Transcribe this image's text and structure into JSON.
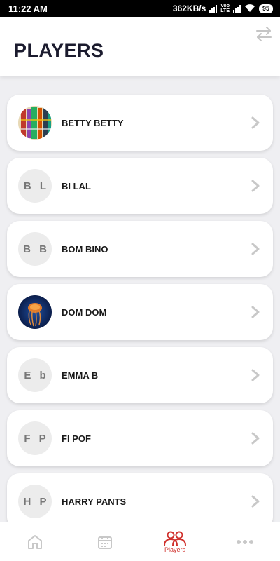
{
  "status_bar": {
    "time": "11:22 AM",
    "speed": "362KB/s",
    "network_label": "Voo LTE",
    "battery": "95"
  },
  "header": {
    "title": "PLAYERS",
    "swap_icon": "swap-arrows-icon"
  },
  "players": [
    {
      "name": "BETTY BETTY",
      "initials": "",
      "avatar": "photo-books"
    },
    {
      "name": "BI LAL",
      "initials": "B L",
      "avatar": "initials"
    },
    {
      "name": "BOM BINO",
      "initials": "B B",
      "avatar": "initials"
    },
    {
      "name": "DOM DOM",
      "initials": "",
      "avatar": "photo-jellyfish"
    },
    {
      "name": "EMMA B",
      "initials": "E b",
      "avatar": "initials"
    },
    {
      "name": "FI POF",
      "initials": "F P",
      "avatar": "initials"
    },
    {
      "name": "HARRY PANTS",
      "initials": "H P",
      "avatar": "initials"
    }
  ],
  "bottom_nav": {
    "items": [
      {
        "icon": "home-icon",
        "label": ""
      },
      {
        "icon": "calendar-icon",
        "label": ""
      },
      {
        "icon": "players-icon",
        "label": "Players",
        "active": true
      },
      {
        "icon": "more-icon",
        "label": ""
      }
    ],
    "active_color": "#d0312d",
    "inactive_color": "#c8c8c8"
  }
}
